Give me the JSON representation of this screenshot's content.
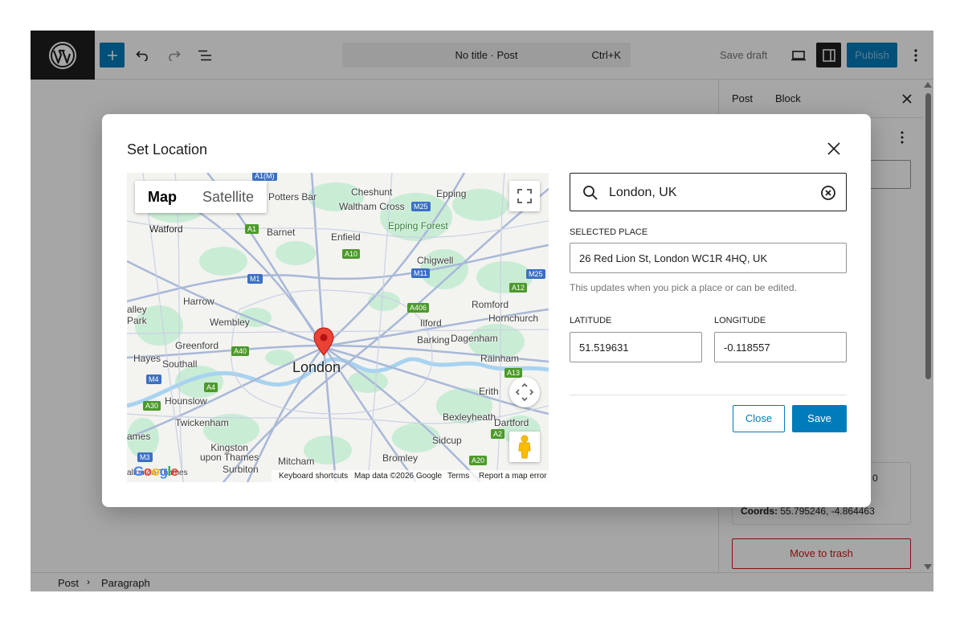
{
  "header": {
    "doc_title": "No title · Post",
    "doc_shortcut": "Ctrl+K",
    "save_draft": "Save draft",
    "publish": "Publish",
    "icons": [
      "wordpress-logo",
      "plus-icon",
      "undo-icon",
      "redo-icon",
      "document-overview-icon",
      "preview-icon",
      "settings-icon",
      "options-icon"
    ]
  },
  "sidebar": {
    "tabs": [
      "Post",
      "Block"
    ],
    "card_extra": "0",
    "coords_label": "Coords:",
    "coords_value": "55.795246, -4.864463",
    "trash": "Move to trash"
  },
  "footer": {
    "breadcrumb": [
      "Post",
      "Paragraph"
    ]
  },
  "modal": {
    "title": "Set Location",
    "search": {
      "value": "London, UK"
    },
    "selected_place": {
      "label": "SELECTED PLACE",
      "value": "26 Red Lion St, London WC1R 4HQ, UK",
      "help": "This updates when you pick a place or can be edited."
    },
    "latitude": {
      "label": "LATITUDE",
      "value": "51.519631"
    },
    "longitude": {
      "label": "LONGITUDE",
      "value": "-0.118557"
    },
    "close_button": "Close",
    "save_button": "Save"
  },
  "map": {
    "type_buttons": [
      "Map",
      "Satellite"
    ],
    "active_type": "Map",
    "google_logo": "Google",
    "attribution": {
      "keyboard": "Keyboard shortcuts",
      "data": "Map data ©2026 Google",
      "terms": "Terms",
      "report": "Report a map error"
    },
    "labels": {
      "london": "London",
      "potters_bar": "Potters Bar",
      "cheshunt": "Cheshunt",
      "waltham_cross": "Waltham Cross",
      "epping": "Epping",
      "epping_forest": "Epping Forest",
      "watford": "Watford",
      "barnet": "Barnet",
      "enfield": "Enfield",
      "chigwell": "Chigwell",
      "harrow": "Harrow",
      "romford": "Romford",
      "hornchurch": "Hornchurch",
      "wembley": "Wembley",
      "ilford": "Ilford",
      "barking": "Barking",
      "dagenham": "Dagenham",
      "greenford": "Greenford",
      "hayes": "Hayes",
      "southall": "Southall",
      "rainham": "Rainham",
      "hounslow": "Hounslow",
      "erith": "Erith",
      "twickenham": "Twickenham",
      "bexleyheath": "Bexleyheath",
      "dartford": "Dartford",
      "sidcup": "Sidcup",
      "kingston": "Kingston\nupon Thames",
      "surbiton": "Surbiton",
      "mitcham": "Mitcham",
      "bromley": "Bromley",
      "park": "Park",
      "valley": "alley",
      "ames": "ames",
      "walton": "alton-on-Thames"
    },
    "roads": [
      "A1(M)",
      "M25",
      "A1",
      "A10",
      "M11",
      "M1",
      "M25",
      "A12",
      "A406",
      "A40",
      "M4",
      "A4",
      "A30",
      "A13",
      "M3",
      "A2",
      "A20"
    ]
  }
}
